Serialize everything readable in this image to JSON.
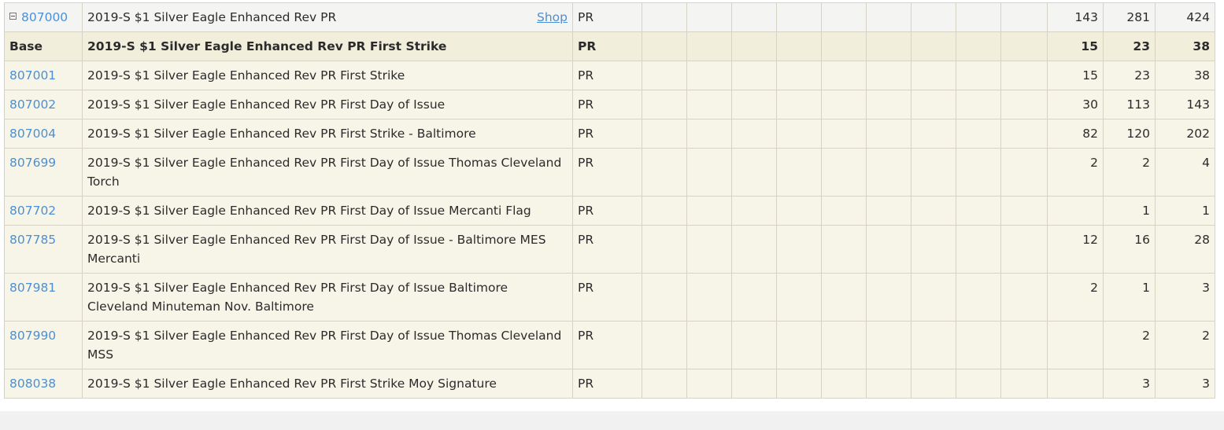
{
  "parent": {
    "spec": "807000",
    "desc": "2019-S $1 Silver Eagle Enhanced Rev PR",
    "shop_label": "Shop",
    "designation": "PR",
    "n1": "143",
    "n2": "281",
    "n3": "424"
  },
  "base": {
    "label": "Base",
    "desc": "2019-S $1 Silver Eagle Enhanced Rev PR First Strike",
    "designation": "PR",
    "n1": "15",
    "n2": "23",
    "n3": "38"
  },
  "rows": [
    {
      "spec": "807001",
      "desc": "2019-S $1 Silver Eagle Enhanced Rev PR First Strike",
      "designation": "PR",
      "n1": "15",
      "n2": "23",
      "n3": "38"
    },
    {
      "spec": "807002",
      "desc": "2019-S $1 Silver Eagle Enhanced Rev PR First Day of Issue",
      "designation": "PR",
      "n1": "30",
      "n2": "113",
      "n3": "143"
    },
    {
      "spec": "807004",
      "desc": "2019-S $1 Silver Eagle Enhanced Rev PR First Strike - Baltimore",
      "designation": "PR",
      "n1": "82",
      "n2": "120",
      "n3": "202"
    },
    {
      "spec": "807699",
      "desc": "2019-S $1 Silver Eagle Enhanced Rev PR First Day of Issue Thomas Cleveland Torch",
      "designation": "PR",
      "n1": "2",
      "n2": "2",
      "n3": "4"
    },
    {
      "spec": "807702",
      "desc": "2019-S $1 Silver Eagle Enhanced Rev PR First Day of Issue Mercanti Flag",
      "designation": "PR",
      "n1": "",
      "n2": "1",
      "n3": "1"
    },
    {
      "spec": "807785",
      "desc": "2019-S $1 Silver Eagle Enhanced Rev PR First Day of Issue - Baltimore MES Mercanti",
      "designation": "PR",
      "n1": "12",
      "n2": "16",
      "n3": "28"
    },
    {
      "spec": "807981",
      "desc": "2019-S $1 Silver Eagle Enhanced Rev PR First Day of Issue Baltimore Cleveland Minuteman Nov. Baltimore",
      "designation": "PR",
      "n1": "2",
      "n2": "1",
      "n3": "3"
    },
    {
      "spec": "807990",
      "desc": "2019-S $1 Silver Eagle Enhanced Rev PR First Day of Issue Thomas Cleveland MSS",
      "designation": "PR",
      "n1": "",
      "n2": "2",
      "n3": "2"
    },
    {
      "spec": "808038",
      "desc": "2019-S $1 Silver Eagle Enhanced Rev PR First Strike Moy Signature",
      "designation": "PR",
      "n1": "",
      "n2": "3",
      "n3": "3"
    }
  ],
  "colors": {
    "link": "#4a90d6",
    "row_bg": "#f7f5e8",
    "base_bg": "#f1eedc",
    "parent_bg": "#f4f4f2",
    "border": "#d6d3c4"
  },
  "icons": {
    "toggle": "collapse-minus-icon"
  }
}
